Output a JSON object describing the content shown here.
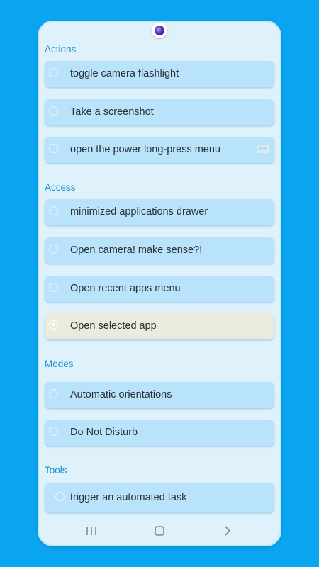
{
  "sections": {
    "actions": {
      "title": "Actions",
      "items": [
        {
          "label": "toggle camera flashlight"
        },
        {
          "label": "Take a screenshot"
        },
        {
          "label": "open the power long-press menu",
          "badge": "new"
        }
      ]
    },
    "access": {
      "title": "Access",
      "items": [
        {
          "label": "minimized applications drawer"
        },
        {
          "label": "Open camera! make sense?!"
        },
        {
          "label": "Open recent apps menu"
        },
        {
          "label": "Open selected app",
          "selected": true
        }
      ]
    },
    "modes": {
      "title": "Modes",
      "items": [
        {
          "label": "Automatic orientations"
        },
        {
          "label": "Do Not Disturb"
        }
      ]
    },
    "tools": {
      "title": "Tools",
      "items": [
        {
          "label": "trigger an automated task"
        }
      ]
    }
  },
  "navbar": {
    "icons": [
      "recent-apps-icon",
      "home-icon",
      "back-icon"
    ]
  },
  "colors": {
    "background": "#0aa5f0",
    "screen": "#dff2fc",
    "item": "#b9e3fb",
    "item_selected": "#ebebdd",
    "section_title": "#1a8fd0"
  }
}
